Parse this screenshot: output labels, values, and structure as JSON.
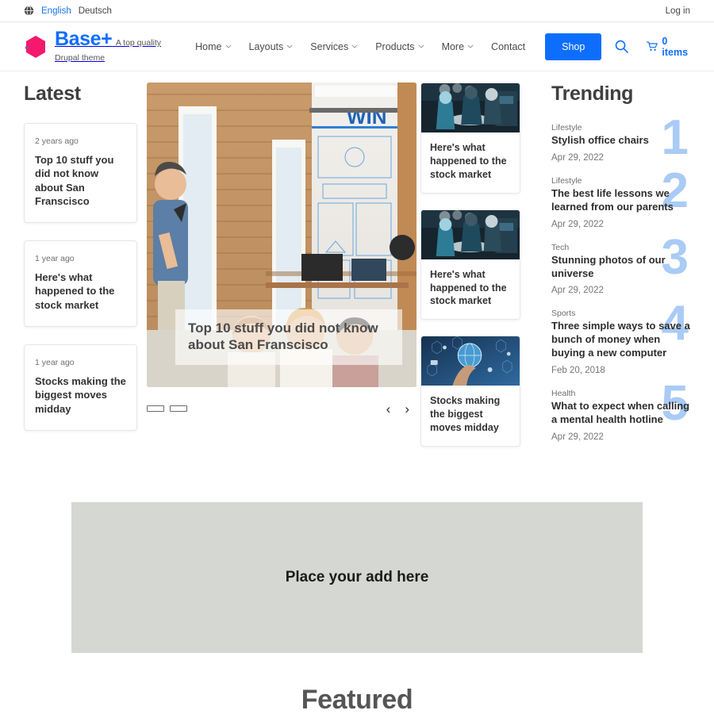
{
  "topbar": {
    "globe_icon": "globe-icon",
    "languages": [
      {
        "label": "English",
        "active": true
      },
      {
        "label": "Deutsch",
        "active": false
      }
    ],
    "login_label": "Log in"
  },
  "header": {
    "brand_name": "Base+",
    "brand_tagline": "A top quality Drupal theme",
    "logo_color": "#f5196e",
    "accent_color": "#0d6efd",
    "nav": [
      {
        "label": "Home",
        "has_dropdown": true
      },
      {
        "label": "Layouts",
        "has_dropdown": true
      },
      {
        "label": "Services",
        "has_dropdown": true
      },
      {
        "label": "Products",
        "has_dropdown": true
      },
      {
        "label": "More",
        "has_dropdown": true
      },
      {
        "label": "Contact",
        "has_dropdown": false
      }
    ],
    "shop_label": "Shop",
    "search_icon": "search-icon",
    "cart_icon": "cart-icon",
    "cart_label": "0 items"
  },
  "latest": {
    "heading": "Latest",
    "cards": [
      {
        "date": "2 years ago",
        "title": "Top 10 stuff you did not know about San Franscisco"
      },
      {
        "date": "1 year ago",
        "title": "Here's what happened to the stock market"
      },
      {
        "date": "1 year ago",
        "title": "Stocks making the biggest moves midday"
      }
    ]
  },
  "hero": {
    "caption": "Top 10 stuff you did not know about San Franscisco",
    "image_alt": "Man presenting to seated colleagues in a brick-walled office",
    "slides": 2,
    "active_slide": 1,
    "prev_label": "‹",
    "next_label": "›"
  },
  "mid_cards": [
    {
      "title": "Here's what happened to the stock market",
      "image_alt": "Surgical team operating in an operating room"
    },
    {
      "title": "Here's what happened to the stock market",
      "image_alt": "Surgical team operating in an operating room"
    },
    {
      "title": "Stocks making the biggest moves midday",
      "image_alt": "Hand touching a glowing digital globe with tech icons"
    }
  ],
  "trending": {
    "heading": "Trending",
    "rank_color": "#a9cbf5",
    "items": [
      {
        "rank": "1",
        "category": "Lifestyle",
        "title": "Stylish office chairs",
        "date": "Apr 29, 2022"
      },
      {
        "rank": "2",
        "category": "Lifestyle",
        "title": "The best life lessons we learned from our parents",
        "date": "Apr 29, 2022"
      },
      {
        "rank": "3",
        "category": "Tech",
        "title": "Stunning photos of our universe",
        "date": "Apr 29, 2022"
      },
      {
        "rank": "4",
        "category": "Sports",
        "title": "Three simple ways to save a bunch of money when buying a new computer",
        "date": "Feb 20, 2018"
      },
      {
        "rank": "5",
        "category": "Health",
        "title": "What to expect when calling a mental health hotline",
        "date": "Apr 29, 2022"
      }
    ]
  },
  "ad": {
    "text": "Place your add here",
    "background": "#d5d8d2"
  },
  "featured": {
    "heading": "Featured"
  }
}
